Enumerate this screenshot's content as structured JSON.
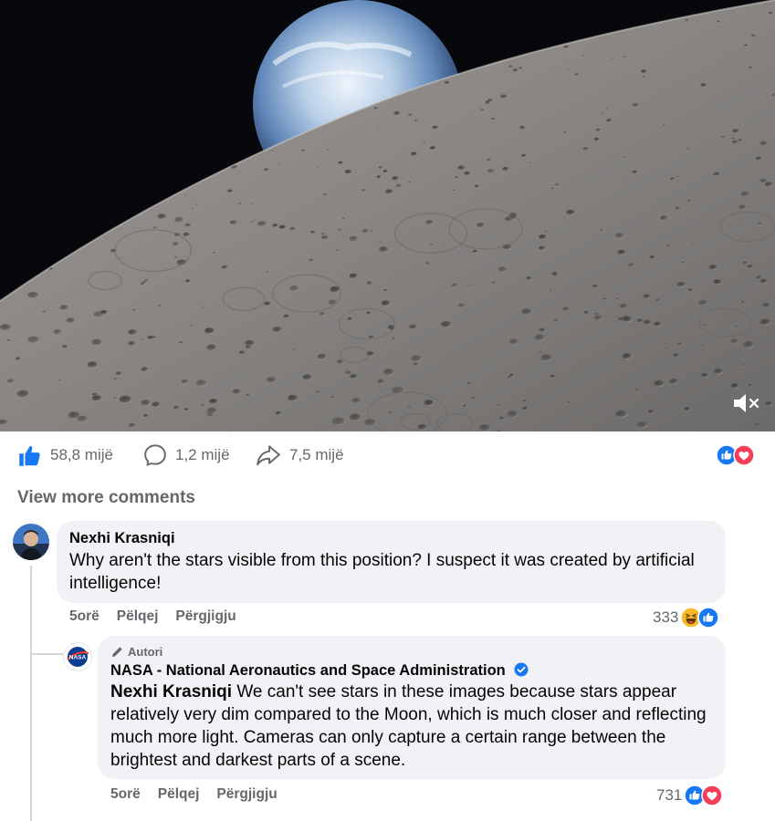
{
  "post": {
    "media": {
      "kind": "video",
      "description_icon": "moon-surface-with-earth",
      "muted_icon": "volume-muted-icon"
    },
    "actions": {
      "likes": "58,8 mijë",
      "comments": "1,2 mijë",
      "shares": "7,5 mijë"
    },
    "reactions": [
      "like",
      "love"
    ],
    "view_more_label": "View more comments"
  },
  "comments": [
    {
      "author": "Nexhi Krasniqi",
      "text": "Why aren't the stars visible from this position? I suspect it was created by artificial intelligence!",
      "time": "5orë",
      "like_label": "Pëlqej",
      "reply_label": "Përgjigju",
      "reaction_count": "333",
      "reactions": [
        "haha",
        "like"
      ]
    },
    {
      "author_badge": "Autori",
      "author": "NASA - National Aeronautics and Space Administration",
      "verified": true,
      "mention": "Nexhi Krasniqi",
      "text": " We can't see stars in these images because stars appear relatively very dim compared to the Moon, which is much closer and reflecting much more light. Cameras can only capture a certain range between the brightest and darkest parts of a scene.",
      "time": "5orë",
      "like_label": "Pëlqej",
      "reply_label": "Përgjigju",
      "reaction_count": "731",
      "reactions": [
        "like",
        "love"
      ]
    }
  ],
  "colors": {
    "like_blue": "#1877f2",
    "love_red": "#f33e58",
    "haha_yellow": "#f7b928",
    "secondary_text": "#65676b",
    "bubble": "#f0f2f5"
  }
}
